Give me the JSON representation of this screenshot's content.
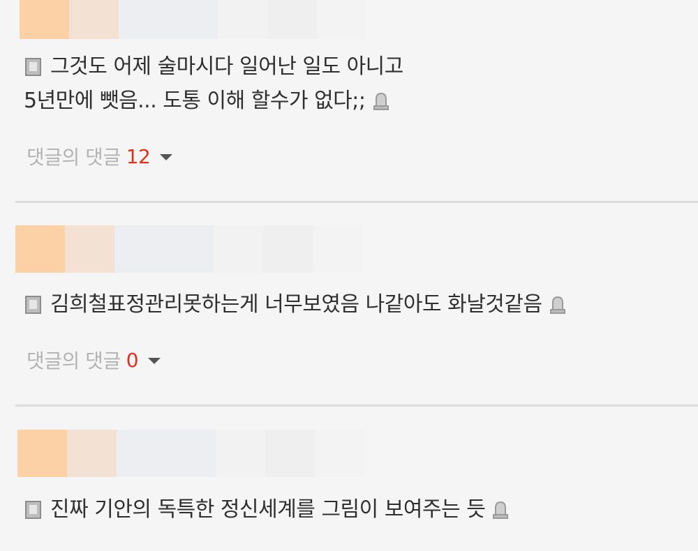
{
  "comments": [
    {
      "lines": [
        "그것도 어제 술마시다 일어난 일도 아니고",
        "5년만에 뺏음... 도통 이해 할수가 없다;;"
      ],
      "reply_label": "댓글의 댓글",
      "reply_count": "12"
    },
    {
      "lines": [
        "김희철표정관리못하는게 너무보였음 나같아도 화날것같음"
      ],
      "reply_label": "댓글의 댓글",
      "reply_count": "0"
    },
    {
      "lines": [
        "진짜 기안의 독특한 정신세계를 그림이 보여주는 듯"
      ]
    }
  ],
  "icons": {
    "comment_prefix": "document-icon",
    "report": "bell-icon",
    "expand": "caret-down-icon"
  },
  "colors": {
    "background": "#f5f5f5",
    "reply_count": "#e0311a",
    "reply_label": "#b3b3b3",
    "divider": "#dcdcdc"
  }
}
